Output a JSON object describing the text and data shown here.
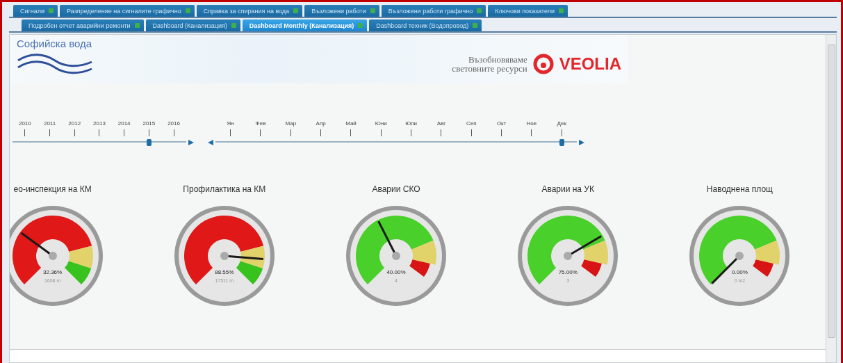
{
  "tab_rows": [
    [
      {
        "label": "Сигнали",
        "selected": false
      },
      {
        "label": "Разпределение на сигналите графично",
        "selected": false
      },
      {
        "label": "Справка за спирания на вода",
        "selected": false
      },
      {
        "label": "Възложени работи",
        "selected": false
      },
      {
        "label": "Възложени работи графично",
        "selected": false
      },
      {
        "label": "Ключови показатели",
        "selected": false
      }
    ],
    [
      {
        "label": "Подробен отчет аварийни ремонти",
        "selected": false
      },
      {
        "label": "Dashboard (Канализация)",
        "selected": false
      },
      {
        "label": "Dashboard Monthly (Канализация)",
        "selected": true
      },
      {
        "label": "Dashboard техник (Водопровод)",
        "selected": false
      }
    ]
  ],
  "header": {
    "brand": "Софийска вода",
    "slogan_line_1": "Възобновяваме",
    "slogan_line_2": "световните ресурси",
    "partner": "VEOLIA"
  },
  "years": [
    {
      "label": "2010",
      "selected": false
    },
    {
      "label": "2011",
      "selected": false
    },
    {
      "label": "2012",
      "selected": false
    },
    {
      "label": "2013",
      "selected": false
    },
    {
      "label": "2014",
      "selected": false
    },
    {
      "label": "2015",
      "selected": true
    },
    {
      "label": "2016",
      "selected": false
    }
  ],
  "months": [
    {
      "label": "Ян",
      "selected": false
    },
    {
      "label": "Фев",
      "selected": false
    },
    {
      "label": "Мар",
      "selected": false
    },
    {
      "label": "Апр",
      "selected": false
    },
    {
      "label": "Май",
      "selected": false
    },
    {
      "label": "Юни",
      "selected": false
    },
    {
      "label": "Юли",
      "selected": false
    },
    {
      "label": "Авг",
      "selected": false
    },
    {
      "label": "Сеп",
      "selected": false
    },
    {
      "label": "Окт",
      "selected": false
    },
    {
      "label": "Ное",
      "selected": false
    },
    {
      "label": "Дек",
      "selected": true
    }
  ],
  "gauges": [
    {
      "title": "ео-инспекция на КМ",
      "kind": "red-first",
      "value": "32.36%",
      "sub": "1608 m"
    },
    {
      "title": "Профилактика на КМ",
      "kind": "red-first",
      "value": "88.55%",
      "sub": "17511 m"
    },
    {
      "title": "Аварии СКО",
      "kind": "green-first",
      "value": "40.00%",
      "sub": "4"
    },
    {
      "title": "Аварии на УК",
      "kind": "green-first",
      "value": "75.00%",
      "sub": "3"
    },
    {
      "title": "Наводнена площ",
      "kind": "green-first",
      "value": "0.00%",
      "sub": "0 m2"
    }
  ]
}
